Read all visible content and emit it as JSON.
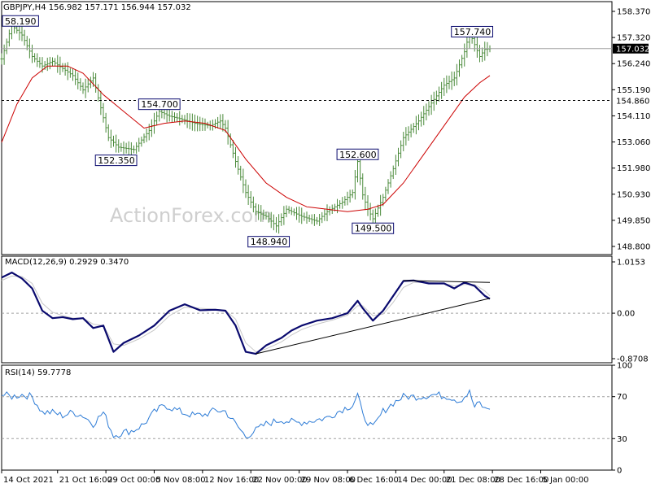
{
  "chart_data": {
    "type": "candlestick",
    "header": "GBPJPY,H4  156.982 157.171 156.944 157.032",
    "watermark": "ActionForex.com",
    "price_panel": {
      "ylim": [
        148.4,
        159.0
      ],
      "y_ticks": [
        "158.370",
        "157.320",
        "156.240",
        "155.190",
        "154.110",
        "153.060",
        "151.980",
        "150.930",
        "149.850",
        "148.800"
      ],
      "ma_color": "#cc0000",
      "bar_color": "#4a8a3a",
      "current_price": "157.032",
      "dashed_level": "154.860",
      "annotations": [
        {
          "label": "58.190",
          "x": 4,
          "y": 158.19
        },
        {
          "label": "154.700",
          "x": 62,
          "y": 154.7
        },
        {
          "label": "152.350",
          "x": 45,
          "y": 152.35
        },
        {
          "label": "148.940",
          "x": 105,
          "y": 148.94
        },
        {
          "label": "152.600",
          "x": 140,
          "y": 152.6
        },
        {
          "label": "149.500",
          "x": 146,
          "y": 149.5
        },
        {
          "label": "157.740",
          "x": 185,
          "y": 157.74
        }
      ],
      "close": [
        [
          0,
          156.6
        ],
        [
          4,
          158.0
        ],
        [
          8,
          157.6
        ],
        [
          12,
          156.7
        ],
        [
          16,
          156.3
        ],
        [
          20,
          156.5
        ],
        [
          24,
          156.2
        ],
        [
          28,
          155.9
        ],
        [
          32,
          155.3
        ],
        [
          36,
          155.8
        ],
        [
          42,
          153.3
        ],
        [
          46,
          152.9
        ],
        [
          52,
          152.8
        ],
        [
          58,
          153.6
        ],
        [
          62,
          154.4
        ],
        [
          66,
          154.2
        ],
        [
          70,
          154.1
        ],
        [
          76,
          153.9
        ],
        [
          82,
          153.8
        ],
        [
          86,
          154.0
        ],
        [
          88,
          153.7
        ],
        [
          92,
          152.3
        ],
        [
          96,
          151.0
        ],
        [
          100,
          150.2
        ],
        [
          104,
          150.0
        ],
        [
          108,
          149.6
        ],
        [
          112,
          150.3
        ],
        [
          118,
          150.0
        ],
        [
          124,
          149.8
        ],
        [
          128,
          150.2
        ],
        [
          134,
          150.6
        ],
        [
          138,
          151.0
        ],
        [
          140,
          152.3
        ],
        [
          142,
          150.9
        ],
        [
          144,
          150.3
        ],
        [
          146,
          149.9
        ],
        [
          150,
          150.8
        ],
        [
          154,
          152.0
        ],
        [
          158,
          153.3
        ],
        [
          164,
          154.0
        ],
        [
          170,
          154.9
        ],
        [
          174,
          155.5
        ],
        [
          178,
          155.8
        ],
        [
          182,
          156.9
        ],
        [
          184,
          157.7
        ],
        [
          188,
          156.7
        ],
        [
          190,
          157.0
        ],
        [
          192,
          157.03
        ]
      ],
      "ma": [
        [
          0,
          153.1
        ],
        [
          6,
          154.7
        ],
        [
          12,
          155.8
        ],
        [
          18,
          156.3
        ],
        [
          26,
          156.3
        ],
        [
          32,
          156.0
        ],
        [
          40,
          155.1
        ],
        [
          48,
          154.4
        ],
        [
          56,
          153.7
        ],
        [
          64,
          153.9
        ],
        [
          72,
          154.0
        ],
        [
          80,
          153.9
        ],
        [
          88,
          153.6
        ],
        [
          96,
          152.4
        ],
        [
          104,
          151.4
        ],
        [
          112,
          150.8
        ],
        [
          120,
          150.4
        ],
        [
          128,
          150.3
        ],
        [
          136,
          150.2
        ],
        [
          144,
          150.3
        ],
        [
          150,
          150.5
        ],
        [
          158,
          151.4
        ],
        [
          166,
          152.6
        ],
        [
          174,
          153.8
        ],
        [
          182,
          155.0
        ],
        [
          188,
          155.6
        ],
        [
          192,
          155.9
        ]
      ]
    },
    "macd_panel": {
      "label": "MACD(12,26,9) 0.2929 0.3470",
      "ylim": [
        -1.0,
        1.15
      ],
      "y_ticks": [
        "1.0153",
        "0.00",
        "-0.8708"
      ],
      "macd": [
        [
          0,
          0.72
        ],
        [
          4,
          0.82
        ],
        [
          8,
          0.7
        ],
        [
          12,
          0.5
        ],
        [
          16,
          0.05
        ],
        [
          20,
          -0.1
        ],
        [
          24,
          -0.08
        ],
        [
          28,
          -0.12
        ],
        [
          32,
          -0.1
        ],
        [
          36,
          -0.3
        ],
        [
          40,
          -0.25
        ],
        [
          44,
          -0.78
        ],
        [
          48,
          -0.6
        ],
        [
          54,
          -0.45
        ],
        [
          60,
          -0.25
        ],
        [
          66,
          0.05
        ],
        [
          72,
          0.18
        ],
        [
          78,
          0.06
        ],
        [
          84,
          0.07
        ],
        [
          88,
          0.05
        ],
        [
          92,
          -0.25
        ],
        [
          96,
          -0.78
        ],
        [
          100,
          -0.82
        ],
        [
          104,
          -0.65
        ],
        [
          110,
          -0.5
        ],
        [
          114,
          -0.35
        ],
        [
          118,
          -0.25
        ],
        [
          124,
          -0.15
        ],
        [
          130,
          -0.1
        ],
        [
          136,
          0.0
        ],
        [
          140,
          0.25
        ],
        [
          142,
          0.1
        ],
        [
          146,
          -0.15
        ],
        [
          150,
          0.05
        ],
        [
          154,
          0.35
        ],
        [
          158,
          0.65
        ],
        [
          162,
          0.66
        ],
        [
          168,
          0.6
        ],
        [
          174,
          0.6
        ],
        [
          178,
          0.5
        ],
        [
          182,
          0.62
        ],
        [
          186,
          0.55
        ],
        [
          190,
          0.35
        ],
        [
          192,
          0.29
        ]
      ],
      "signal": [
        [
          0,
          0.66
        ],
        [
          4,
          0.75
        ],
        [
          8,
          0.74
        ],
        [
          12,
          0.6
        ],
        [
          16,
          0.2
        ],
        [
          20,
          0.02
        ],
        [
          24,
          -0.05
        ],
        [
          28,
          -0.1
        ],
        [
          32,
          -0.1
        ],
        [
          36,
          -0.22
        ],
        [
          40,
          -0.25
        ],
        [
          44,
          -0.62
        ],
        [
          48,
          -0.65
        ],
        [
          54,
          -0.52
        ],
        [
          60,
          -0.34
        ],
        [
          66,
          -0.05
        ],
        [
          72,
          0.12
        ],
        [
          78,
          0.1
        ],
        [
          84,
          0.08
        ],
        [
          88,
          0.06
        ],
        [
          92,
          -0.12
        ],
        [
          96,
          -0.6
        ],
        [
          100,
          -0.78
        ],
        [
          104,
          -0.72
        ],
        [
          110,
          -0.58
        ],
        [
          114,
          -0.44
        ],
        [
          118,
          -0.33
        ],
        [
          124,
          -0.22
        ],
        [
          130,
          -0.14
        ],
        [
          136,
          -0.04
        ],
        [
          140,
          0.15
        ],
        [
          142,
          0.15
        ],
        [
          146,
          -0.05
        ],
        [
          150,
          -0.02
        ],
        [
          154,
          0.22
        ],
        [
          158,
          0.52
        ],
        [
          162,
          0.62
        ],
        [
          168,
          0.62
        ],
        [
          174,
          0.6
        ],
        [
          178,
          0.55
        ],
        [
          182,
          0.58
        ],
        [
          186,
          0.58
        ],
        [
          190,
          0.45
        ],
        [
          192,
          0.35
        ]
      ],
      "trendlines": [
        {
          "from": [
            100,
            -0.82
          ],
          "to": [
            192,
            0.3
          ]
        },
        {
          "from": [
            158,
            0.66
          ],
          "to": [
            192,
            0.62
          ]
        }
      ],
      "macd_color": "#0a0a6e",
      "signal_color": "#c8c8c8"
    },
    "rsi_panel": {
      "label": "RSI(14) 59.7778",
      "ylim": [
        0,
        100
      ],
      "y_ticks": [
        100,
        70,
        30,
        0
      ],
      "levels": [
        70,
        30
      ],
      "color": "#2e7cd6",
      "values": [
        [
          0,
          72
        ],
        [
          4,
          70
        ],
        [
          8,
          72
        ],
        [
          12,
          70
        ],
        [
          16,
          55
        ],
        [
          20,
          55
        ],
        [
          24,
          52
        ],
        [
          28,
          55
        ],
        [
          32,
          52
        ],
        [
          36,
          44
        ],
        [
          40,
          55
        ],
        [
          44,
          33
        ],
        [
          48,
          36
        ],
        [
          52,
          38
        ],
        [
          56,
          44
        ],
        [
          60,
          55
        ],
        [
          64,
          62
        ],
        [
          68,
          58
        ],
        [
          72,
          54
        ],
        [
          76,
          52
        ],
        [
          80,
          53
        ],
        [
          84,
          57
        ],
        [
          88,
          56
        ],
        [
          92,
          44
        ],
        [
          96,
          32
        ],
        [
          100,
          38
        ],
        [
          104,
          44
        ],
        [
          110,
          48
        ],
        [
          116,
          45
        ],
        [
          122,
          47
        ],
        [
          128,
          50
        ],
        [
          134,
          58
        ],
        [
          138,
          62
        ],
        [
          140,
          72
        ],
        [
          142,
          52
        ],
        [
          146,
          40
        ],
        [
          150,
          56
        ],
        [
          154,
          64
        ],
        [
          158,
          70
        ],
        [
          164,
          70
        ],
        [
          170,
          72
        ],
        [
          176,
          70
        ],
        [
          180,
          66
        ],
        [
          184,
          74
        ],
        [
          186,
          60
        ],
        [
          188,
          64
        ],
        [
          190,
          58
        ],
        [
          192,
          59.8
        ]
      ]
    },
    "x_ticks": [
      {
        "label": "14 Oct 2021",
        "x": 0
      },
      {
        "label": "21 Oct 16:00",
        "x": 22
      },
      {
        "label": "29 Oct 00:00",
        "x": 41
      },
      {
        "label": "5 Nov 08:00",
        "x": 60
      },
      {
        "label": "12 Nov 16:00",
        "x": 79
      },
      {
        "label": "22 Nov 00:00",
        "x": 98
      },
      {
        "label": "29 Nov 08:00",
        "x": 117
      },
      {
        "label": "6 Dec 16:00",
        "x": 136
      },
      {
        "label": "14 Dec 00:00",
        "x": 155
      },
      {
        "label": "21 Dec 08:00",
        "x": 174
      },
      {
        "label": "28 Dec 16:00",
        "x": 193
      },
      {
        "label": "5 Jan 00:00",
        "x": 212
      }
    ],
    "x_range": [
      0,
      240
    ],
    "plot_end_x": 192
  }
}
